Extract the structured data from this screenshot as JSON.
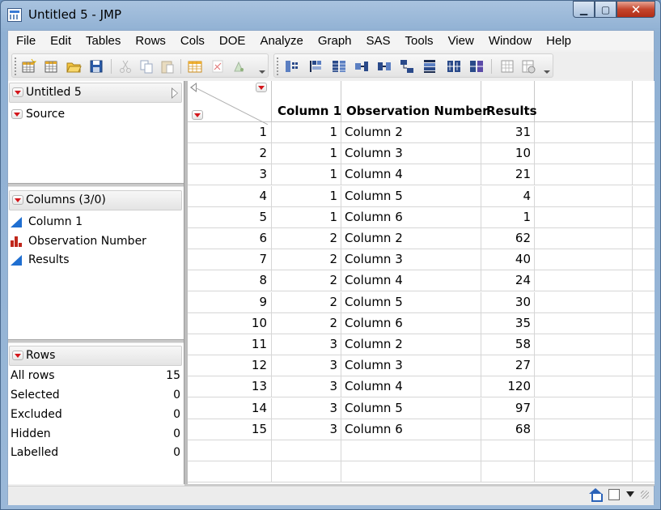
{
  "window": {
    "title": "Untitled 5 - JMP"
  },
  "menu": [
    "File",
    "Edit",
    "Tables",
    "Rows",
    "Cols",
    "DOE",
    "Analyze",
    "Graph",
    "SAS",
    "Tools",
    "View",
    "Window",
    "Help"
  ],
  "toolbar": {
    "group1": [
      "new-data-table-icon",
      "open-data-table-icon",
      "open-folder-icon",
      "save-icon",
      "cut-icon",
      "copy-icon",
      "paste-icon",
      "data-table-icon",
      "clear-icon",
      "arrow-tool-icon"
    ],
    "group2": [
      "split-icon",
      "stack-icon",
      "join-icon",
      "update-icon",
      "sort-icon",
      "subset-icon",
      "concatenate-icon",
      "transpose-icon",
      "tabulate-icon",
      "summary-icon"
    ]
  },
  "table_panel": {
    "title": "Untitled 5",
    "script": "Source"
  },
  "columns_panel": {
    "title": "Columns (3/0)",
    "items": [
      {
        "name": "Column 1",
        "icon": "continuous-icon"
      },
      {
        "name": "Observation Number",
        "icon": "nominal-icon"
      },
      {
        "name": "Results",
        "icon": "continuous-icon"
      }
    ]
  },
  "rows_panel": {
    "title": "Rows",
    "stats": [
      {
        "label": "All rows",
        "value": "15"
      },
      {
        "label": "Selected",
        "value": "0"
      },
      {
        "label": "Excluded",
        "value": "0"
      },
      {
        "label": "Hidden",
        "value": "0"
      },
      {
        "label": "Labelled",
        "value": "0"
      }
    ]
  },
  "grid": {
    "headers": [
      "Column 1",
      "Observation Number",
      "Results"
    ],
    "rows": [
      {
        "n": "1",
        "c1": "1",
        "obs": "Column 2",
        "res": "31"
      },
      {
        "n": "2",
        "c1": "1",
        "obs": "Column 3",
        "res": "10"
      },
      {
        "n": "3",
        "c1": "1",
        "obs": "Column 4",
        "res": "21"
      },
      {
        "n": "4",
        "c1": "1",
        "obs": "Column 5",
        "res": "4"
      },
      {
        "n": "5",
        "c1": "1",
        "obs": "Column 6",
        "res": "1"
      },
      {
        "n": "6",
        "c1": "2",
        "obs": "Column 2",
        "res": "62"
      },
      {
        "n": "7",
        "c1": "2",
        "obs": "Column 3",
        "res": "40"
      },
      {
        "n": "8",
        "c1": "2",
        "obs": "Column 4",
        "res": "24"
      },
      {
        "n": "9",
        "c1": "2",
        "obs": "Column 5",
        "res": "30"
      },
      {
        "n": "10",
        "c1": "2",
        "obs": "Column 6",
        "res": "35"
      },
      {
        "n": "11",
        "c1": "3",
        "obs": "Column 2",
        "res": "58"
      },
      {
        "n": "12",
        "c1": "3",
        "obs": "Column 3",
        "res": "27"
      },
      {
        "n": "13",
        "c1": "3",
        "obs": "Column 4",
        "res": "120"
      },
      {
        "n": "14",
        "c1": "3",
        "obs": "Column 5",
        "res": "97"
      },
      {
        "n": "15",
        "c1": "3",
        "obs": "Column 6",
        "res": "68"
      }
    ]
  },
  "statusbar": {
    "icons": [
      "home-icon",
      "window-list-icon",
      "dropdown-icon"
    ]
  },
  "colors": {
    "red_triangle": "#d4161b",
    "continuous_icon": "#1f6fd1",
    "nominal_icon": "#c0271c",
    "close_button": "#c4452c"
  }
}
